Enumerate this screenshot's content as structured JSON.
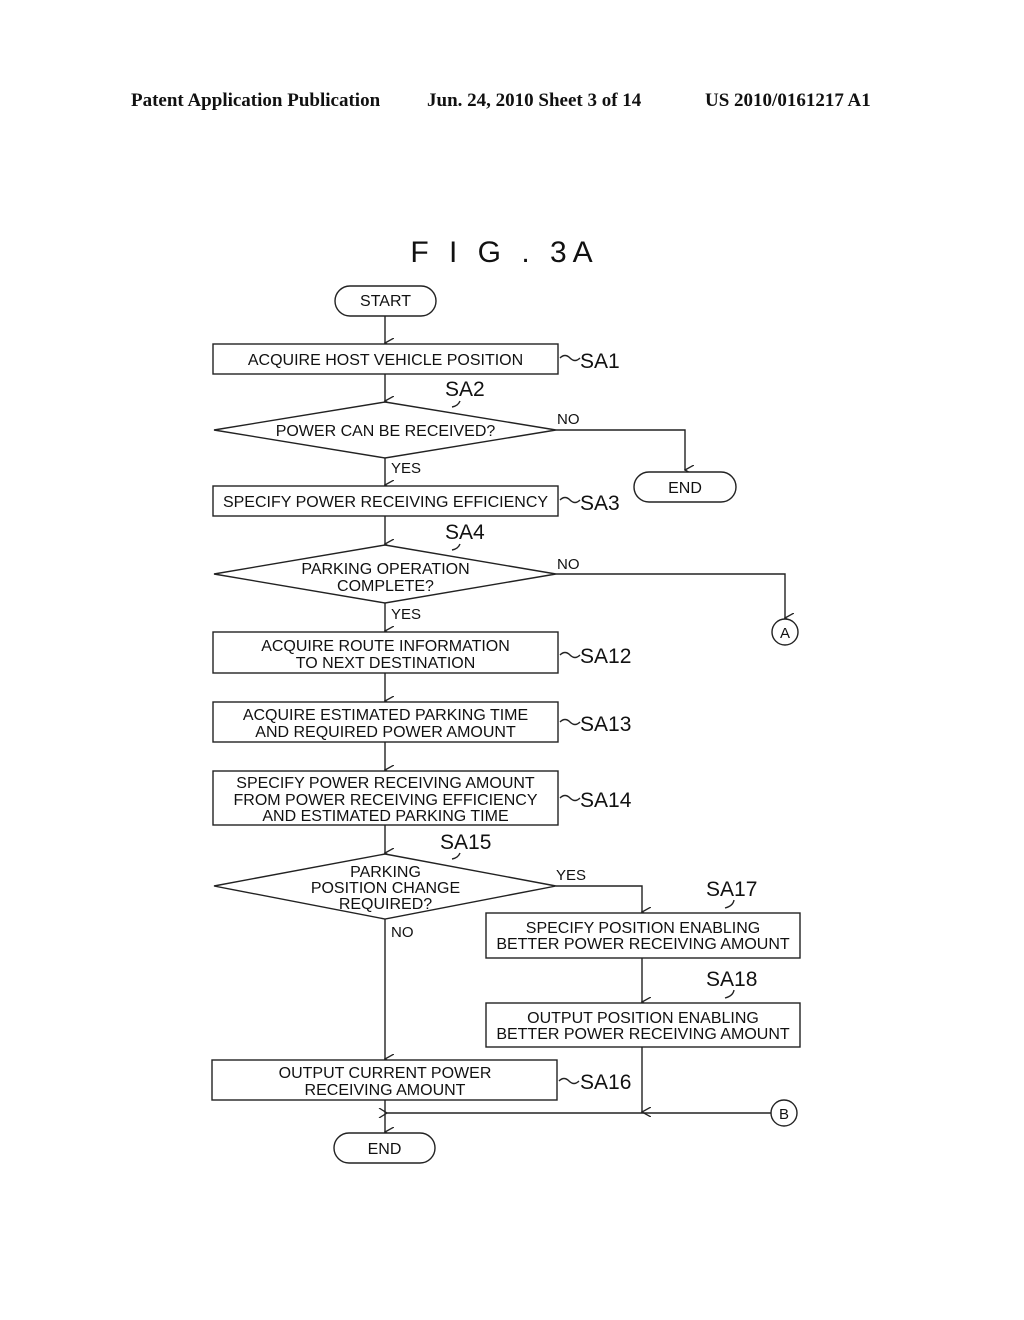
{
  "header": {
    "publication": "Patent Application Publication",
    "date_sheet": "Jun. 24, 2010  Sheet 3 of 14",
    "number": "US 2010/0161217 A1"
  },
  "figure": {
    "title": "F I G . 3A"
  },
  "flowchart": {
    "terminals": {
      "start": "START",
      "end_sa2": "END",
      "end_final": "END"
    },
    "connectors": {
      "a": "A",
      "b": "B"
    },
    "steps": {
      "sa1": {
        "id": "SA1",
        "lines": [
          "ACQUIRE HOST VEHICLE POSITION"
        ]
      },
      "sa2": {
        "id": "SA2",
        "lines": [
          "POWER CAN BE RECEIVED?"
        ]
      },
      "sa3": {
        "id": "SA3",
        "lines": [
          "SPECIFY POWER RECEIVING EFFICIENCY"
        ]
      },
      "sa4": {
        "id": "SA4",
        "lines": [
          "PARKING OPERATION",
          "COMPLETE?"
        ]
      },
      "sa12": {
        "id": "SA12",
        "lines": [
          "ACQUIRE ROUTE INFORMATION",
          "TO NEXT DESTINATION"
        ]
      },
      "sa13": {
        "id": "SA13",
        "lines": [
          "ACQUIRE ESTIMATED PARKING TIME",
          "AND REQUIRED POWER AMOUNT"
        ]
      },
      "sa14": {
        "id": "SA14",
        "lines": [
          "SPECIFY POWER RECEIVING AMOUNT",
          "FROM POWER RECEIVING EFFICIENCY",
          "AND ESTIMATED PARKING TIME"
        ]
      },
      "sa15": {
        "id": "SA15",
        "lines": [
          "PARKING",
          "POSITION CHANGE",
          "REQUIRED?"
        ]
      },
      "sa16": {
        "id": "SA16",
        "lines": [
          "OUTPUT CURRENT POWER",
          "RECEIVING AMOUNT"
        ]
      },
      "sa17": {
        "id": "SA17",
        "lines": [
          "SPECIFY POSITION ENABLING",
          "BETTER POWER RECEIVING AMOUNT"
        ]
      },
      "sa18": {
        "id": "SA18",
        "lines": [
          "OUTPUT POSITION ENABLING",
          "BETTER POWER RECEIVING AMOUNT"
        ]
      }
    },
    "branch_labels": {
      "sa2_no": "NO",
      "sa2_yes": "YES",
      "sa4_no": "NO",
      "sa4_yes": "YES",
      "sa15_yes": "YES",
      "sa15_no": "NO"
    }
  }
}
